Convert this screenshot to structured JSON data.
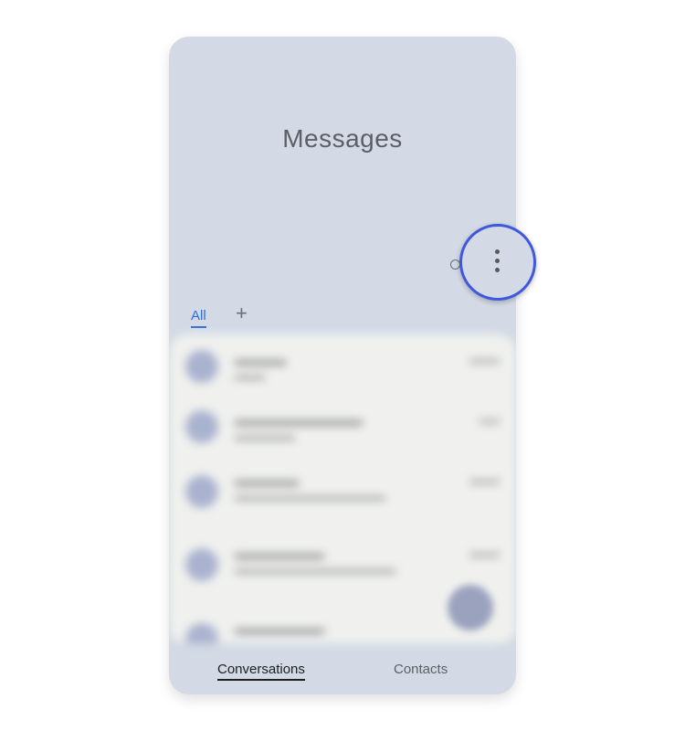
{
  "app": {
    "title": "Messages"
  },
  "toolbar": {
    "search_icon": "search-icon",
    "more_icon": "more-vert-icon"
  },
  "filter_tabs": {
    "items": [
      {
        "label": "All",
        "selected": true
      }
    ],
    "add_label": "+"
  },
  "bottom_nav": {
    "items": [
      {
        "label": "Conversations",
        "selected": true
      },
      {
        "label": "Contacts",
        "selected": false
      }
    ]
  },
  "colors": {
    "background": "#d3dae5",
    "accent": "#2f6fd1",
    "highlight_ring": "#3f58e0",
    "list_background": "#f0f1ee"
  }
}
